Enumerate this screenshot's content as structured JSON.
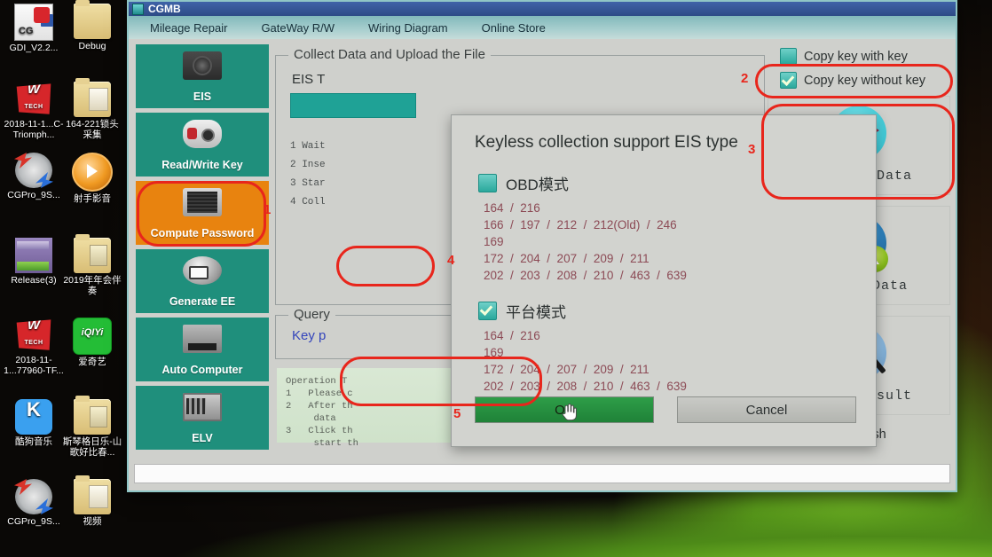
{
  "desktop": {
    "icons": [
      {
        "label": "GDI_V2.2...",
        "icon": "cgdi-app-icon",
        "kind": "cgdi"
      },
      {
        "label": "Debug",
        "icon": "folder-icon",
        "kind": "folder"
      },
      {
        "label": "2018-11-1...C-Triomph...",
        "icon": "tech-app-icon",
        "kind": "tech"
      },
      {
        "label": "164-221锁头采集",
        "icon": "folder-doc-icon",
        "kind": "folderdoc"
      },
      {
        "label": "CGPro_9S...",
        "icon": "cgpro-app-icon",
        "kind": "cgpro"
      },
      {
        "label": "射手影音",
        "icon": "media-player-icon",
        "kind": "play"
      },
      {
        "label": "Release(3)",
        "icon": "winrar-archive-icon",
        "kind": "zip"
      },
      {
        "label": "2019年年会伴奏",
        "icon": "folder-media-icon",
        "kind": "foldermedia"
      },
      {
        "label": "2018-11-1...77960-TF...",
        "icon": "tech-app-icon",
        "kind": "tech"
      },
      {
        "label": "爱奇艺",
        "icon": "iqiyi-icon",
        "kind": "iqiyi"
      },
      {
        "label": "酷狗音乐",
        "icon": "kugou-music-icon",
        "kind": "kugou"
      },
      {
        "label": "斯琴格日乐-山歌好比春...",
        "icon": "folder-media-icon",
        "kind": "foldermedia"
      },
      {
        "label": "CGPro_9S...",
        "icon": "cgpro-app-icon",
        "kind": "cgpro"
      },
      {
        "label": "视频",
        "icon": "folder-doc-icon",
        "kind": "folderdoc"
      }
    ]
  },
  "window": {
    "title": "CGMB",
    "menu": [
      "Mileage Repair",
      "GateWay R/W",
      "Wiring Diagram",
      "Online Store"
    ]
  },
  "rail": {
    "items": [
      {
        "label": "EIS",
        "icon": "eis-module-icon",
        "kind": "eis",
        "active": false
      },
      {
        "label": "Read/Write Key",
        "icon": "car-key-icon",
        "kind": "key",
        "active": false
      },
      {
        "label": "Compute Password",
        "icon": "cpu-chip-icon",
        "kind": "cpu",
        "active": true
      },
      {
        "label": "Generate EE",
        "icon": "printer-icon",
        "kind": "print",
        "active": false
      },
      {
        "label": "Auto Computer",
        "icon": "ecu-icon",
        "kind": "ecu",
        "active": false
      },
      {
        "label": "ELV",
        "icon": "elv-board-icon",
        "kind": "elv",
        "active": false
      }
    ]
  },
  "center": {
    "collect_group_title": "Collect Data and Upload the File",
    "eis_type_label": "EIS T",
    "steps": [
      "1 Wait",
      "2 Inse",
      "3 Star",
      "4 Coll"
    ],
    "query_group_title": "Query",
    "query_key_text": "Key p",
    "tips": [
      "Operation T",
      "1   Please c",
      "2   After th",
      "     data",
      "3   Click th",
      "     start th"
    ]
  },
  "right": {
    "copy_with_key": {
      "label": "Copy key with key",
      "checked": false
    },
    "copy_without_key": {
      "label": "Copy key without key",
      "checked": true
    },
    "buttons": [
      {
        "label": "Collect Data",
        "icon": "usb-collect-icon",
        "kind": "usb"
      },
      {
        "label": "Upload  Data",
        "icon": "globe-upload-icon",
        "kind": "globe"
      },
      {
        "label": "Query Result",
        "icon": "magnifier-query-icon",
        "kind": "mag"
      }
    ],
    "auto_refresh": {
      "label": "Auto Refresh",
      "checked": true
    }
  },
  "dialog": {
    "title": "Keyless collection support EIS type",
    "obd": {
      "label": "OBD模式",
      "checked": false,
      "rows": [
        "164  /  216",
        "166  /  197  /  212  /  212(Old)  /  246",
        "169",
        "172  /  204  /  207  /  209  /  211",
        "202  /  203  /  208  /  210  /  463  /  639"
      ]
    },
    "platform": {
      "label": "平台模式",
      "checked": true,
      "rows": [
        "164  /  216",
        "169",
        "172  /  204  /  207  /  209  /  211",
        "202  /  203  /  208  /  210  /  463  /  639"
      ]
    },
    "ok_label": "OK",
    "cancel_label": "Cancel"
  },
  "annotations": {
    "color": "#e8261c",
    "marks": [
      "1",
      "2",
      "3",
      "4",
      "5"
    ]
  }
}
